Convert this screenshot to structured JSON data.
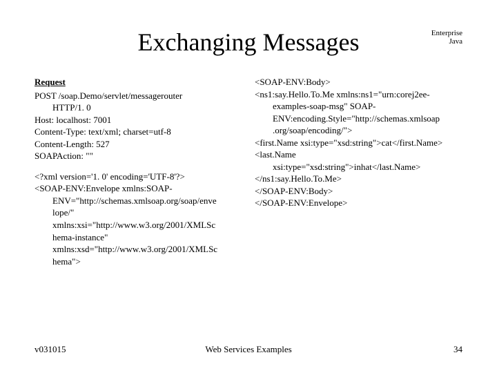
{
  "header": {
    "title": "Exchanging Messages",
    "corner": "Enterprise\nJava"
  },
  "left": {
    "heading": "Request",
    "http1": "POST /soap.Demo/servlet/messagerouter",
    "http1_indent": "HTTP/1. 0",
    "http2": "Host: localhost: 7001",
    "http3": "Content-Type: text/xml; charset=utf-8",
    "http4": "Content-Length: 527",
    "http5": "SOAPAction: \"\"",
    "xml1": "<?xml version='1. 0' encoding='UTF-8'?>",
    "xml2": "<SOAP-ENV:Envelope xmlns:SOAP-",
    "xml2_i1": "ENV=\"http://schemas.xmlsoap.org/soap/enve",
    "xml2_i2": "lope/\"",
    "xml2_i3": "xmlns:xsi=\"http://www.w3.org/2001/XMLSc",
    "xml2_i4": "hema-instance\"",
    "xml2_i5": "xmlns:xsd=\"http://www.w3.org/2001/XMLSc",
    "xml2_i6": "hema\">"
  },
  "right": {
    "l1": "<SOAP-ENV:Body>",
    "l2": "<ns1:say.Hello.To.Me xmlns:ns1=\"urn:corej2ee-",
    "l2_i1": "examples-soap-msg\" SOAP-",
    "l2_i2": "ENV:encoding.Style=\"http://schemas.xmlsoap",
    "l2_i3": ".org/soap/encoding/\">",
    "l3": "<first.Name xsi:type=\"xsd:string\">cat</first.Name>",
    "l4": "<last.Name",
    "l4_i1": "xsi:type=\"xsd:string\">inhat</last.Name>",
    "l5": "</ns1:say.Hello.To.Me>",
    "l6": "</SOAP-ENV:Body>",
    "l7": "</SOAP-ENV:Envelope>"
  },
  "footer": {
    "left": "v031015",
    "center": "Web Services Examples",
    "right": "34"
  }
}
